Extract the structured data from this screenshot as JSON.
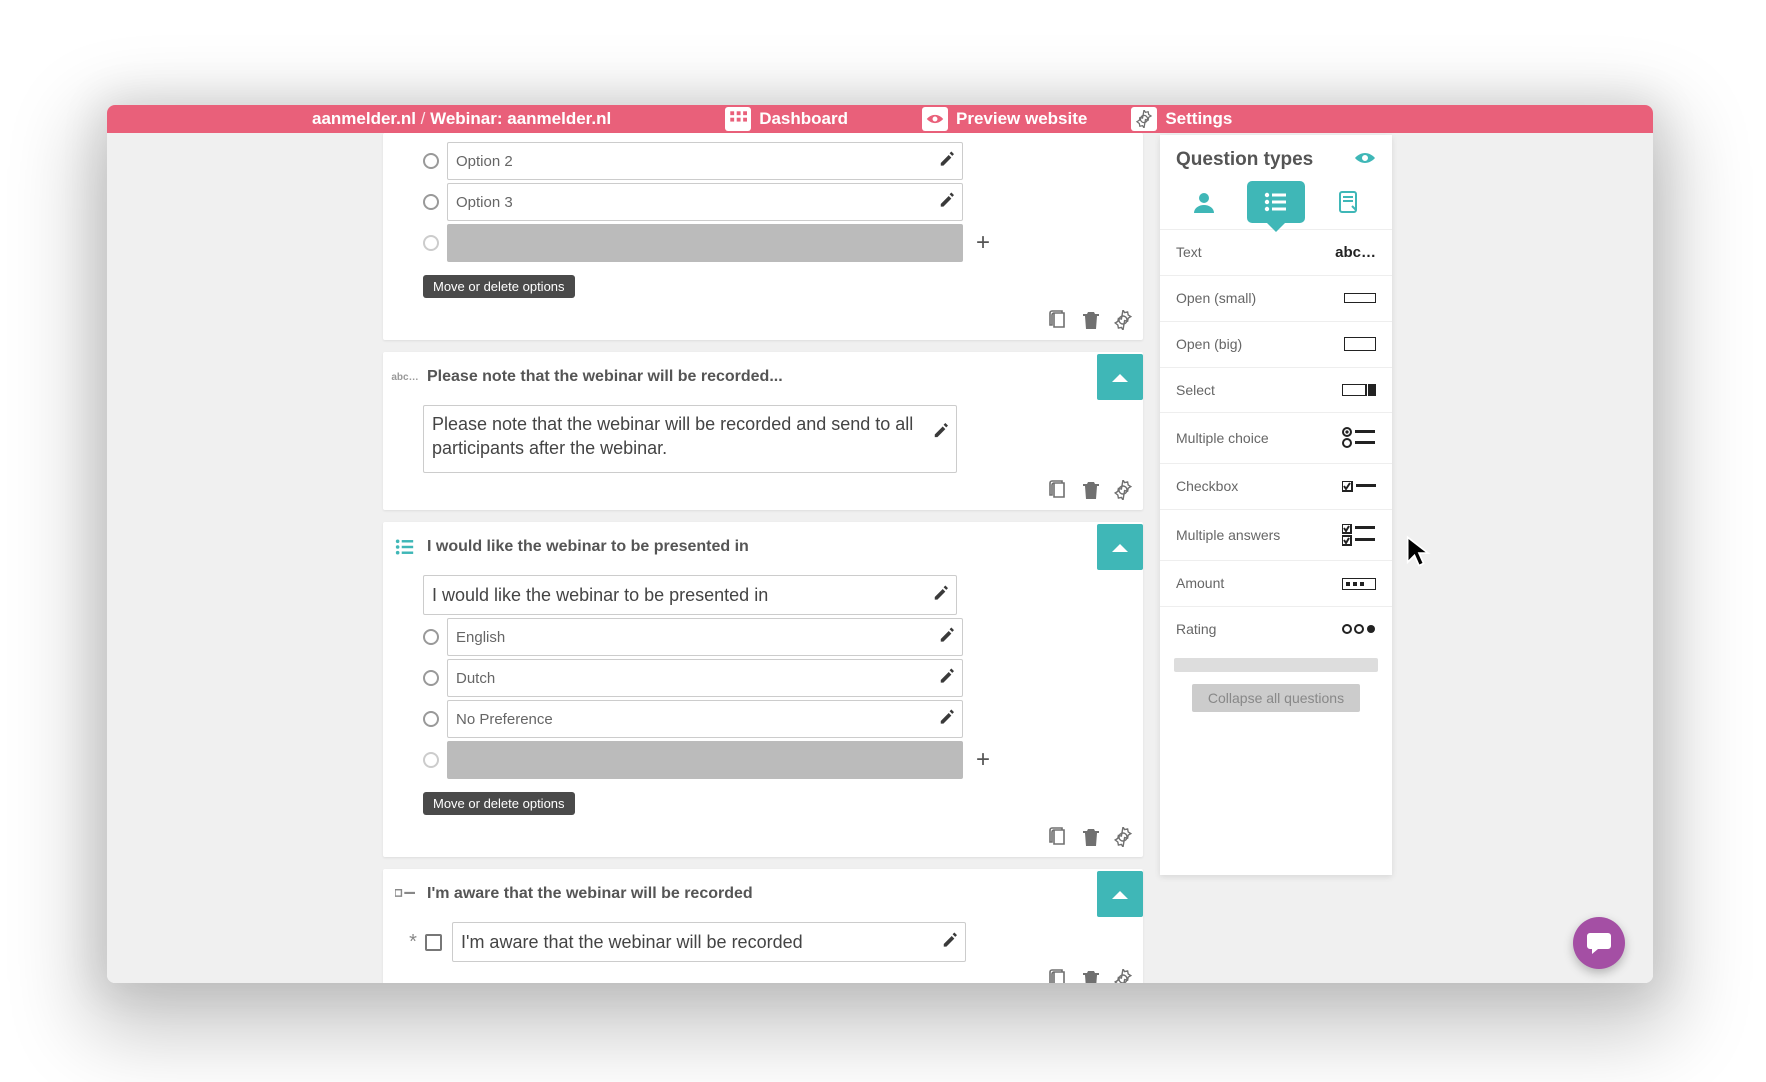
{
  "header": {
    "site": "aanmelder.nl",
    "sep": " / ",
    "page": "Webinar: aanmelder.nl",
    "nav": {
      "dashboard": "Dashboard",
      "preview": "Preview website",
      "settings": "Settings"
    }
  },
  "q1": {
    "options": {
      "b": "Option 2",
      "c": "Option 3"
    },
    "chip": "Move or delete options"
  },
  "q2": {
    "title": "Please note that the webinar will be recorded...",
    "body": "Please note that the webinar will be recorded and send to all participants after the webinar."
  },
  "q3": {
    "title": "I would like the webinar to be presented in",
    "field": "I would like the webinar to be presented in",
    "options": {
      "a": "English",
      "b": "Dutch",
      "c": "No Preference"
    },
    "chip": "Move or delete options"
  },
  "q4": {
    "title": "I'm aware that the webinar will be recorded",
    "field": "I'm aware that the webinar will be recorded"
  },
  "side": {
    "title": "Question types",
    "rows": {
      "text": "Text",
      "text_glyph": "abc…",
      "open_small": "Open (small)",
      "open_big": "Open (big)",
      "select": "Select",
      "multiple_choice": "Multiple choice",
      "checkbox": "Checkbox",
      "multiple_answers": "Multiple answers",
      "amount": "Amount",
      "rating": "Rating"
    },
    "collapse": "Collapse all questions"
  }
}
